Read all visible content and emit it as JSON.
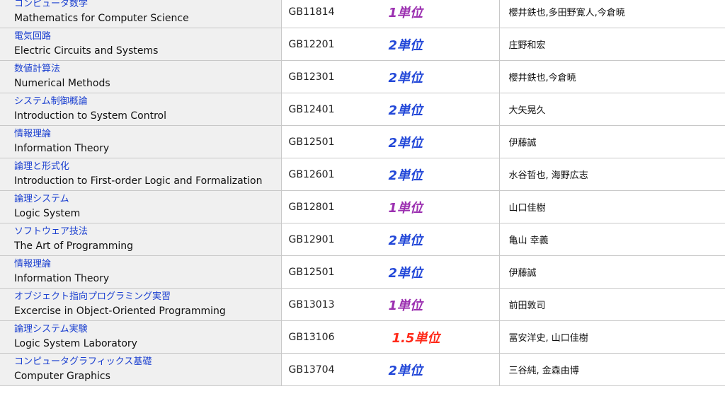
{
  "courses": [
    {
      "name_ja": "コンピュータ数学",
      "name_en": "Mathematics for Computer Science",
      "code": "GB11814",
      "credits": "1単位",
      "credit_color": "purple",
      "instructor": "櫻井鉄也,多田野寛人,今倉暁"
    },
    {
      "name_ja": "電気回路",
      "name_en": "Electric Circuits and Systems",
      "code": "GB12201",
      "credits": "2単位",
      "credit_color": "blue",
      "instructor": "庄野和宏"
    },
    {
      "name_ja": "数値計算法",
      "name_en": "Numerical Methods",
      "code": "GB12301",
      "credits": "2単位",
      "credit_color": "blue",
      "instructor": "櫻井鉄也,今倉暁"
    },
    {
      "name_ja": "システム制御概論",
      "name_en": "Introduction to System Control",
      "code": "GB12401",
      "credits": "2単位",
      "credit_color": "blue",
      "instructor": "大矢晃久"
    },
    {
      "name_ja": "情報理論",
      "name_en": "Information Theory",
      "code": "GB12501",
      "credits": "2単位",
      "credit_color": "blue",
      "instructor": "伊藤誠"
    },
    {
      "name_ja": "論理と形式化",
      "name_en": "Introduction to First-order Logic and Formalization",
      "code": "GB12601",
      "credits": "2単位",
      "credit_color": "blue",
      "instructor": "水谷哲也, 海野広志"
    },
    {
      "name_ja": "論理システム",
      "name_en": "Logic System",
      "code": "GB12801",
      "credits": "1単位",
      "credit_color": "purple",
      "instructor": "山口佳樹"
    },
    {
      "name_ja": "ソフトウェア技法",
      "name_en": "The Art of Programming",
      "code": "GB12901",
      "credits": "2単位",
      "credit_color": "blue",
      "instructor": "亀山 幸義"
    },
    {
      "name_ja": "情報理論",
      "name_en": "Information Theory",
      "code": "GB12501",
      "credits": "2単位",
      "credit_color": "blue",
      "instructor": "伊藤誠"
    },
    {
      "name_ja": "オブジェクト指向プログラミング実習",
      "name_en": "Excercise in Object-Oriented Programming",
      "code": "GB13013",
      "credits": "1単位",
      "credit_color": "purple",
      "instructor": "前田敦司"
    },
    {
      "name_ja": "論理システム実験",
      "name_en": "Logic System Laboratory",
      "code": "GB13106",
      "credits": "1.5単位",
      "credit_color": "red",
      "instructor": "冨安洋史, 山口佳樹"
    },
    {
      "name_ja": "コンピュータグラフィックス基礎",
      "name_en": "Computer Graphics",
      "code": "GB13704",
      "credits": "2単位",
      "credit_color": "blue",
      "instructor": "三谷純, 金森由博"
    }
  ]
}
